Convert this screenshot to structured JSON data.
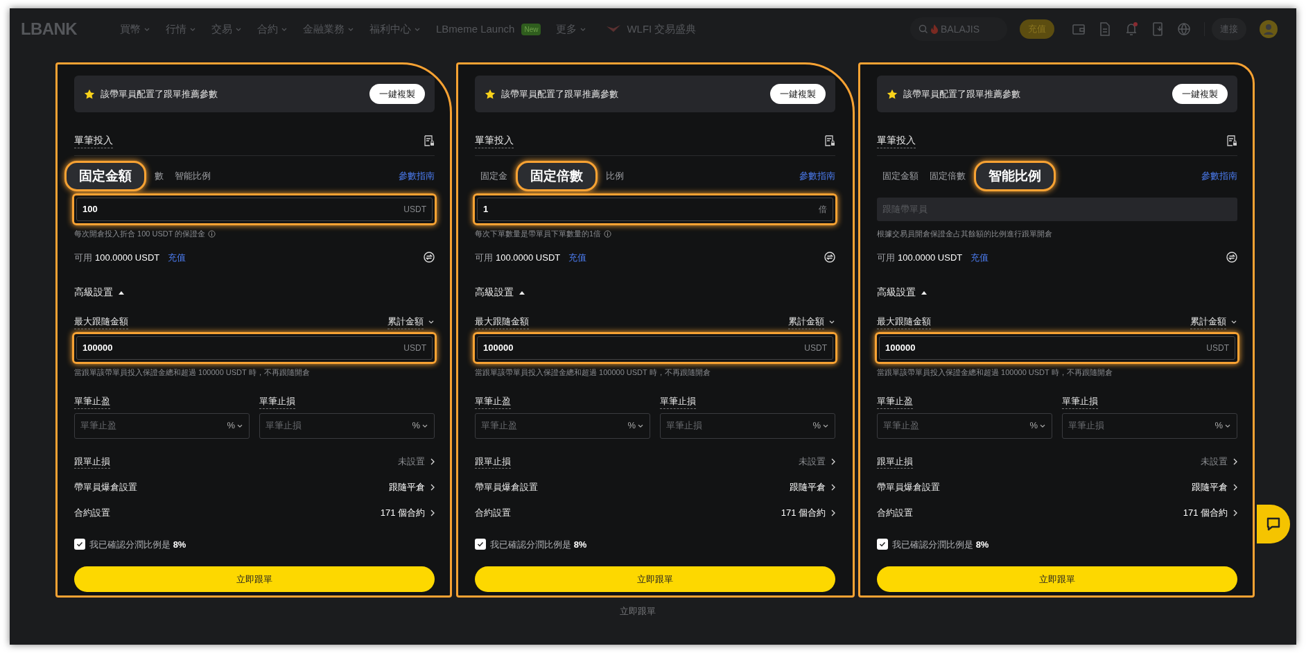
{
  "nav": {
    "logo": "LBANK",
    "menu": [
      {
        "label": "買幣",
        "caret": true
      },
      {
        "label": "行情",
        "caret": true
      },
      {
        "label": "交易",
        "caret": true
      },
      {
        "label": "合約",
        "caret": true
      },
      {
        "label": "金融業務",
        "caret": true
      },
      {
        "label": "福利中心",
        "caret": true
      },
      {
        "label": "LBmeme Launch",
        "caret": false,
        "badge": "New"
      },
      {
        "label": "更多",
        "caret": true
      }
    ],
    "promo": "WLFI 交易盛典",
    "search": {
      "placeholder": "BALAJIS"
    },
    "deposit": "充值",
    "notification_dot": true,
    "connect": "連接"
  },
  "background": {
    "button": "立即跟單"
  },
  "panels": [
    {
      "banner": {
        "text": "該帶單員配置了跟單推薦參數",
        "button": "一鍵複製"
      },
      "section_title": "單筆投入",
      "tabs": [
        {
          "label": "固定金額",
          "selected": true
        },
        {
          "label": "數",
          "selected": false
        },
        {
          "label": "智能比例",
          "selected": false
        }
      ],
      "guide": "參數指南",
      "amount": {
        "value": "100",
        "unit": "USDT",
        "highlighted": true
      },
      "hint": "每次開倉投入折合 100 USDT 的保證金",
      "hint_info": true,
      "available": {
        "label": "可用",
        "value": "100.0000 USDT",
        "link": "充值"
      },
      "advanced": {
        "label": "高級設置",
        "expanded": true
      },
      "max_follow": {
        "label": "最大跟隨金額",
        "mode": "累計金額",
        "value": "100000",
        "unit": "USDT",
        "highlighted": true,
        "hint": "當跟單該帶單員投入保證金總和超過 100000 USDT 時，不再跟隨開倉"
      },
      "stops": [
        {
          "label": "單筆止盈",
          "placeholder": "單筆止盈",
          "unit": "%"
        },
        {
          "label": "單筆止損",
          "placeholder": "單筆止損",
          "unit": "%"
        }
      ],
      "rows": [
        {
          "label": "跟單止損",
          "value": "未設置",
          "dashed": true,
          "muted": true
        },
        {
          "label": "帶單員爆倉設置",
          "value": "跟隨平倉",
          "dashed": false,
          "muted": false
        },
        {
          "label": "合約設置",
          "value": "171 個合約",
          "dashed": false,
          "muted": false
        }
      ],
      "confirm": {
        "text": "我已確認分潤比例是 **8%**",
        "checked": true
      },
      "submit": "立即跟單"
    },
    {
      "banner": {
        "text": "該帶單員配置了跟單推薦參數",
        "button": "一鍵複製"
      },
      "section_title": "單筆投入",
      "tabs": [
        {
          "label": "固定金",
          "selected": false
        },
        {
          "label": "固定倍數",
          "selected": true
        },
        {
          "label": "比例",
          "selected": false
        }
      ],
      "guide": "參數指南",
      "amount": {
        "value": "1",
        "unit": "倍",
        "highlighted": true
      },
      "hint": "每次下單數量是帶單員下單數量的1倍",
      "hint_info": true,
      "available": {
        "label": "可用",
        "value": "100.0000 USDT",
        "link": "充值"
      },
      "advanced": {
        "label": "高級設置",
        "expanded": true
      },
      "max_follow": {
        "label": "最大跟隨金額",
        "mode": "累計金額",
        "value": "100000",
        "unit": "USDT",
        "highlighted": true,
        "hint": "當跟單該帶單員投入保證金總和超過 100000 USDT 時，不再跟隨開倉"
      },
      "stops": [
        {
          "label": "單筆止盈",
          "placeholder": "單筆止盈",
          "unit": "%"
        },
        {
          "label": "單筆止損",
          "placeholder": "單筆止損",
          "unit": "%"
        }
      ],
      "rows": [
        {
          "label": "跟單止損",
          "value": "未設置",
          "dashed": true,
          "muted": true
        },
        {
          "label": "帶單員爆倉設置",
          "value": "跟隨平倉",
          "dashed": false,
          "muted": false
        },
        {
          "label": "合約設置",
          "value": "171 個合約",
          "dashed": false,
          "muted": false
        }
      ],
      "confirm": {
        "text": "我已確認分潤比例是 **8%**",
        "checked": true
      },
      "submit": "立即跟單"
    },
    {
      "banner": {
        "text": "該帶單員配置了跟單推薦參數",
        "button": "一鍵複製"
      },
      "section_title": "單筆投入",
      "tabs": [
        {
          "label": "固定金額",
          "selected": false
        },
        {
          "label": "固定倍數",
          "selected": false
        },
        {
          "label": "智能比例",
          "selected": true
        }
      ],
      "guide": "參數指南",
      "amount": {
        "placeholder": "跟隨帶單員",
        "highlighted": false
      },
      "hint": "根據交易員開倉保證金占其餘額的比例進行跟單開倉",
      "hint_info": false,
      "available": {
        "label": "可用",
        "value": "100.0000 USDT",
        "link": "充值"
      },
      "advanced": {
        "label": "高級設置",
        "expanded": true
      },
      "max_follow": {
        "label": "最大跟隨金額",
        "mode": "累計金額",
        "value": "100000",
        "unit": "USDT",
        "highlighted": true,
        "hint": "當跟單該帶單員投入保證金總和超過 100000 USDT 時，不再跟隨開倉"
      },
      "stops": [
        {
          "label": "單筆止盈",
          "placeholder": "單筆止盈",
          "unit": "%"
        },
        {
          "label": "單筆止損",
          "placeholder": "單筆止損",
          "unit": "%"
        }
      ],
      "rows": [
        {
          "label": "跟單止損",
          "value": "未設置",
          "dashed": true,
          "muted": true
        },
        {
          "label": "帶單員爆倉設置",
          "value": "跟隨平倉",
          "dashed": false,
          "muted": false
        },
        {
          "label": "合約設置",
          "value": "171 個合約",
          "dashed": false,
          "muted": false
        }
      ],
      "confirm": {
        "text": "我已確認分潤比例是 **8%**",
        "checked": true
      },
      "submit": "立即跟單"
    }
  ]
}
